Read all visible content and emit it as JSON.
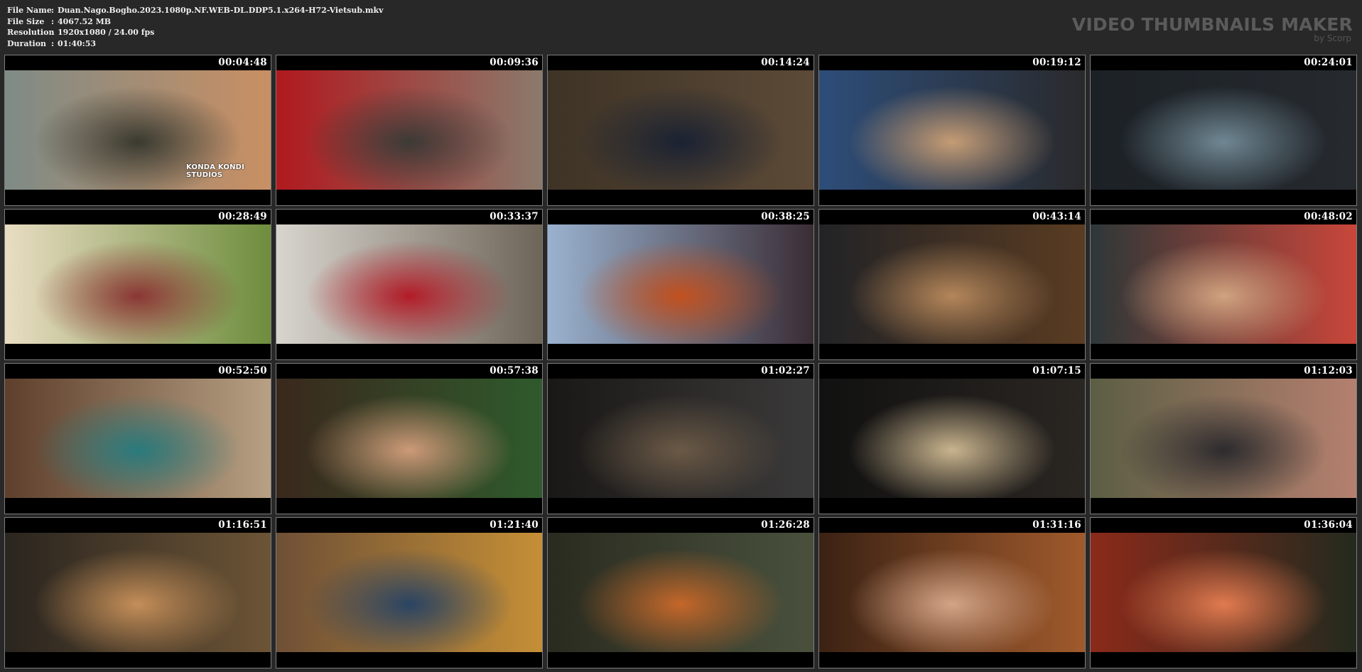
{
  "info": {
    "rows": [
      {
        "label": "File Name",
        "sep": ":",
        "value": "Duan.Nago.Bogho.2023.1080p.NF.WEB-DL.DDP5.1.x264-H72-Vietsub.mkv"
      },
      {
        "label": "File Size",
        "sep": ":",
        "value": "4067.52 MB"
      },
      {
        "label": "Resolution",
        "sep": ":",
        "value": "1920x1080 / 24.00 fps"
      },
      {
        "label": "Duration",
        "sep": ":",
        "value": "01:40:53"
      }
    ]
  },
  "brand": {
    "title": "VIDEO THUMBNAILS MAKER",
    "subtitle": "by Scorp"
  },
  "frame_credit": "KONDA KONDI STUDIOS",
  "thumbnails": [
    {
      "timestamp": "00:04:48",
      "colors": [
        "#7f8b86",
        "#3a3a30",
        "#c98f63"
      ]
    },
    {
      "timestamp": "00:09:36",
      "colors": [
        "#b0191e",
        "#3c3a36",
        "#8b7a6c"
      ]
    },
    {
      "timestamp": "00:14:24",
      "colors": [
        "#3e3326",
        "#1a2232",
        "#5c4a37"
      ]
    },
    {
      "timestamp": "00:19:12",
      "colors": [
        "#2d4d79",
        "#c59c74",
        "#2a2a2c"
      ]
    },
    {
      "timestamp": "00:24:01",
      "colors": [
        "#1c2126",
        "#6f8793",
        "#262a2f"
      ]
    },
    {
      "timestamp": "00:28:49",
      "colors": [
        "#e9ddc3",
        "#8a3733",
        "#6e8d3d"
      ]
    },
    {
      "timestamp": "00:33:37",
      "colors": [
        "#d8d5ce",
        "#b21c28",
        "#6e6559"
      ]
    },
    {
      "timestamp": "00:38:25",
      "colors": [
        "#9ab2cf",
        "#c1501f",
        "#3a2d35"
      ]
    },
    {
      "timestamp": "00:43:14",
      "colors": [
        "#222326",
        "#b4865a",
        "#5a3c22"
      ]
    },
    {
      "timestamp": "00:48:02",
      "colors": [
        "#2d3838",
        "#d0a27f",
        "#c9463a"
      ]
    },
    {
      "timestamp": "00:52:50",
      "colors": [
        "#5e3f2c",
        "#2a7a7c",
        "#b7a083"
      ]
    },
    {
      "timestamp": "00:57:38",
      "colors": [
        "#3a281d",
        "#cd9a78",
        "#2f5a2c"
      ]
    },
    {
      "timestamp": "01:02:27",
      "colors": [
        "#1a1816",
        "#6b5946",
        "#3b3a3a"
      ]
    },
    {
      "timestamp": "01:07:15",
      "colors": [
        "#111111",
        "#c9b48e",
        "#2a2622"
      ]
    },
    {
      "timestamp": "01:12:03",
      "colors": [
        "#5b5e44",
        "#2d2b2e",
        "#b5806f"
      ]
    },
    {
      "timestamp": "01:16:51",
      "colors": [
        "#2a251f",
        "#c48e58",
        "#6c5436"
      ]
    },
    {
      "timestamp": "01:21:40",
      "colors": [
        "#6e5036",
        "#2a4463",
        "#c58f36"
      ]
    },
    {
      "timestamp": "01:26:28",
      "colors": [
        "#2a2b1f",
        "#c46729",
        "#49513d"
      ]
    },
    {
      "timestamp": "01:31:16",
      "colors": [
        "#3b2214",
        "#d4a487",
        "#a05a2c"
      ]
    },
    {
      "timestamp": "01:36:04",
      "colors": [
        "#8b2a1a",
        "#e07a4f",
        "#242a1e"
      ]
    }
  ]
}
